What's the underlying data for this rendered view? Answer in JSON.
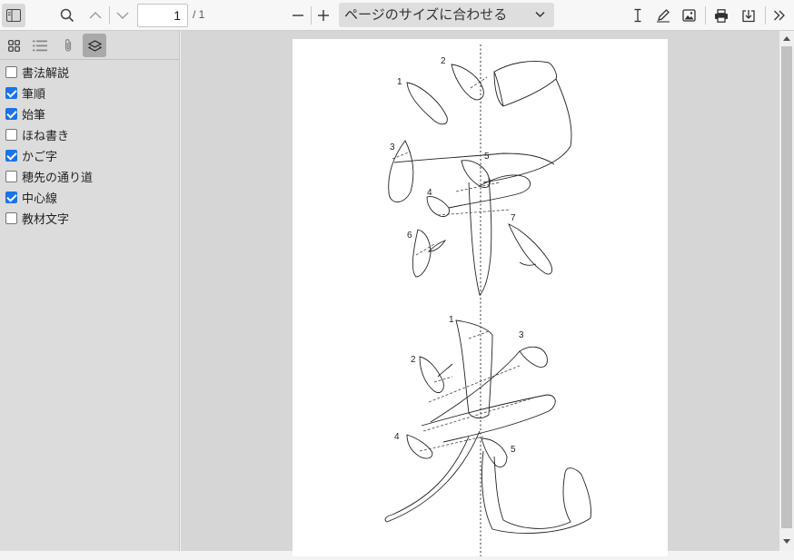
{
  "toolbar": {
    "page_number": "1",
    "page_total": "/ 1",
    "zoom_label": "ページのサイズに合わせる",
    "buttons": [
      "sidebar-toggle-icon",
      "search-icon",
      "chevron-up-icon",
      "chevron-down-icon",
      "zoom-out-icon",
      "zoom-in-icon",
      "text-cursor-icon",
      "pen-icon",
      "image-icon",
      "print-icon",
      "download-icon",
      "more-icon"
    ]
  },
  "sidebar": {
    "tabs": [
      "thumbnails-icon",
      "outline-icon",
      "attachment-icon",
      "layers-icon"
    ],
    "active_tab": "layers",
    "layers": [
      {
        "label": "書法解説",
        "checked": false
      },
      {
        "label": "筆順",
        "checked": true
      },
      {
        "label": "始筆",
        "checked": true
      },
      {
        "label": "ほね書き",
        "checked": false
      },
      {
        "label": "かご字",
        "checked": true
      },
      {
        "label": "穂先の通り道",
        "checked": false
      },
      {
        "label": "中心線",
        "checked": true
      },
      {
        "label": "教材文字",
        "checked": false
      }
    ]
  },
  "document": {
    "stroke_numbers_top": [
      "1",
      "2",
      "3",
      "4",
      "5",
      "6",
      "7"
    ],
    "stroke_numbers_bottom": [
      "1",
      "2",
      "3",
      "4",
      "5"
    ]
  },
  "colors": {
    "accent": "#1a73e8",
    "sidebar_bg": "#dcdcdc",
    "viewer_bg": "#d6d6d6"
  }
}
